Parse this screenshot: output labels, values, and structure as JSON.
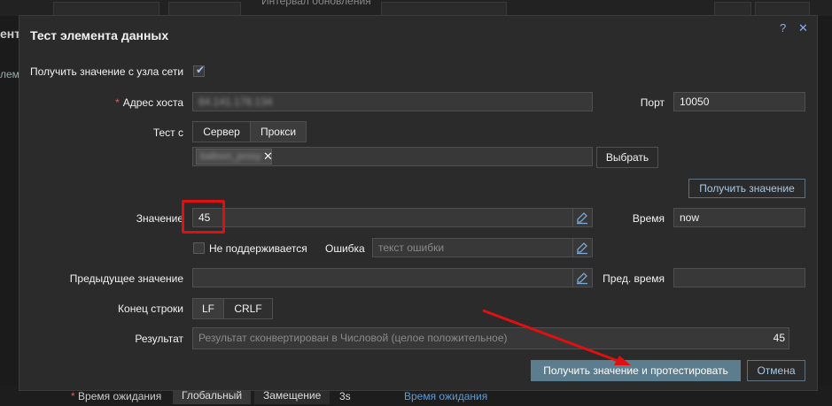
{
  "background": {
    "top_field_label": "Интервал обновления",
    "left_title": "ент",
    "left_tab": "лемент",
    "bottom_label": "Время ожидания",
    "bottom_seg_global": "Глобальный",
    "bottom_seg_override": "Замещение",
    "bottom_value": "3s",
    "bottom_link": "Время ожидания"
  },
  "dialog": {
    "title": "Тест элемента данных",
    "help_icon": "?",
    "close_icon": "✕",
    "get_from_host_label": "Получить значение с узла сети",
    "get_from_host_checked": true,
    "host_label": "Адрес хоста",
    "host_value": "84.141.178.134",
    "port_label": "Порт",
    "port_value": "10050",
    "test_with_label": "Тест с",
    "seg_server": "Сервер",
    "seg_proxy": "Прокси",
    "proxy_tag": "balloon_proxy",
    "select_button": "Выбрать",
    "get_value_button": "Получить значение",
    "value_label": "Значение",
    "value": "45",
    "time_label": "Время",
    "time_value": "now",
    "not_supported_label": "Не поддерживается",
    "error_label": "Ошибка",
    "error_placeholder": "текст ошибки",
    "prev_value_label": "Предыдущее значение",
    "prev_value": "",
    "prev_time_label": "Пред. время",
    "prev_time_value": "",
    "eol_label": "Конец строки",
    "eol_lf": "LF",
    "eol_crlf": "CRLF",
    "result_label": "Результат",
    "result_text": "Результат сконвертирован в Числовой (целое положительное)",
    "result_value": "45",
    "get_and_test_button": "Получить значение и протестировать",
    "cancel_button": "Отмена"
  },
  "colors": {
    "highlight_box": "#e01010",
    "annotation_arrow": "#e01010",
    "primary_button": "#5b7d8e"
  }
}
